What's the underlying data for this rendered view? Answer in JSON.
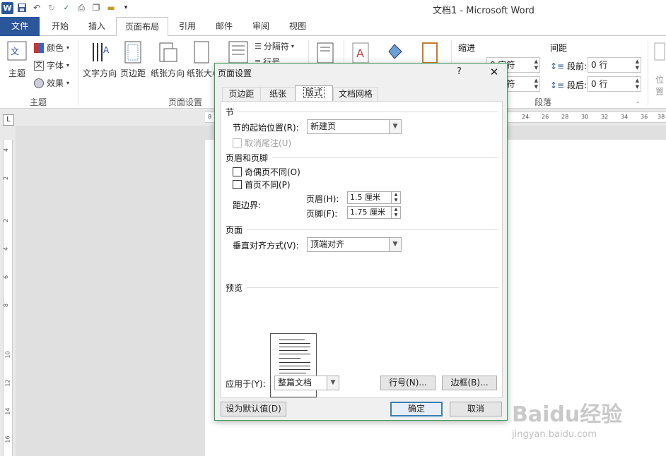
{
  "window": {
    "title": "文档1 - Microsoft Word"
  },
  "tabs": [
    {
      "label": "文件"
    },
    {
      "label": "开始"
    },
    {
      "label": "插入"
    },
    {
      "label": "页面布局"
    },
    {
      "label": "引用"
    },
    {
      "label": "邮件"
    },
    {
      "label": "审阅"
    },
    {
      "label": "视图"
    }
  ],
  "ribbon": {
    "theme_group": {
      "label": "主题",
      "theme": "主题",
      "colors": "颜色",
      "fonts": "字体",
      "effects": "效果"
    },
    "page_setup_group": {
      "label": "页面设置",
      "text_direction": "文字方向",
      "margins": "页边距",
      "orientation": "纸张方向",
      "size": "纸张大小",
      "breaks": "分隔符",
      "line_numbers": "行号"
    },
    "paragraph_group": {
      "label": "段落",
      "indent": "缩进",
      "indent_left": "0 字符",
      "indent_right": "0 字符",
      "spacing": "间距",
      "before_label": "段前:",
      "before_value": "0 行",
      "after_label": "段后:",
      "after_value": "0 行",
      "position": "位置"
    }
  },
  "ruler": {
    "h": [
      "8",
      "24",
      "26",
      "28",
      "30",
      "32",
      "34",
      "36",
      "38"
    ],
    "v": [
      "4",
      "2",
      "2",
      "4",
      "6",
      "8",
      "10",
      "12",
      "14",
      "16"
    ]
  },
  "dialog": {
    "title": "页面设置",
    "help": "?",
    "close": "✕",
    "tabs": [
      "页边距",
      "纸张",
      "版式",
      "文档网格"
    ],
    "section": {
      "heading": "节",
      "start_label": "节的起始位置(R):",
      "start_value": "新建页",
      "suppress_endnotes": "取消尾注(U)"
    },
    "headers_footers": {
      "heading": "页眉和页脚",
      "odd_even": "奇偶页不同(O)",
      "first_page": "首页不同(P)",
      "from_edge": "距边界:",
      "header_label": "页眉(H):",
      "header_value": "1.5 厘米",
      "footer_label": "页脚(F):",
      "footer_value": "1.75 厘米"
    },
    "page": {
      "heading": "页面",
      "valign_label": "垂直对齐方式(V):",
      "valign_value": "顶端对齐"
    },
    "preview": {
      "heading": "预览"
    },
    "apply_to_label": "应用于(Y):",
    "apply_to_value": "整篇文档",
    "line_numbers_button": "行号(N)...",
    "borders_button": "边框(B)...",
    "set_default_button": "设为默认值(D)",
    "ok_button": "确定",
    "cancel_button": "取消"
  },
  "watermark": {
    "line1": "Baidu经验",
    "line2": "jingyan.baidu.com"
  }
}
